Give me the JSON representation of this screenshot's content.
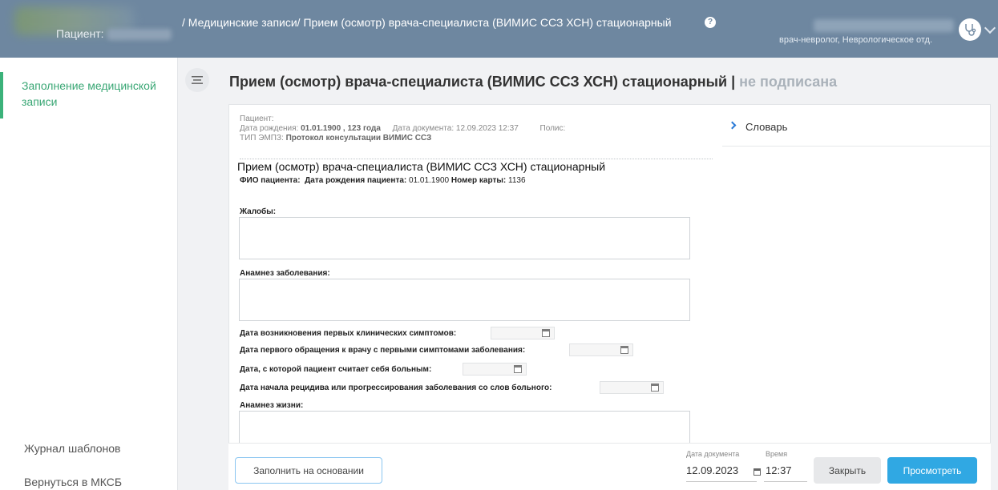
{
  "header": {
    "patient_label": "Пациент:",
    "breadcrumb": "/ Медицинские записи/ Прием (осмотр) врача-специалиста (ВИМИС ССЗ ХСН) стационарный",
    "help_icon": "?",
    "user_role": "врач-невролог, Неврологическое отд."
  },
  "sidebar": {
    "active_item": "Заполнение медицинской записи",
    "templates": "Журнал шаблонов",
    "back": "Вернуться в МКСБ"
  },
  "main": {
    "title": "Прием (осмотр) врача-специалиста (ВИМИС ССЗ ХСН) стационарный | ",
    "status": "не подписана",
    "dictionary": "Словарь"
  },
  "meta": {
    "patient_label": "Пациент:",
    "birth_label": "Дата рождения:",
    "birth_value": "01.01.1900 , 123 года",
    "doc_date_label": "Дата документа:",
    "doc_date_value": "12.09.2023 12:37",
    "policy_label": "Полис:",
    "type_label": "ТИП ЭМПЗ:",
    "type_value": "Протокол консультации ВИМИС ССЗ"
  },
  "document": {
    "title": "Прием (осмотр) врача-специалиста (ВИМИС ССЗ ХСН) стационарный",
    "fio_label": "ФИО пациента:",
    "dob_label": "Дата рождения пациента:",
    "dob_value": "01.01.1900",
    "card_label": "Номер карты:",
    "card_value": "1136",
    "complaints_label": "Жалобы:",
    "anamnesis_label": "Анамнез заболевания:",
    "date_first_symptoms": "Дата возникновения первых клинических симптомов:",
    "date_first_visit": "Дата первого обращения к врачу с первыми симптомами заболевания:",
    "date_ill_since": "Дата, с которой пациент считает себя больным:",
    "date_relapse": "Дата начала рецидива или прогрессирования заболевания со слов больного:",
    "life_anamnesis_label": "Анамнез жизни:"
  },
  "footer": {
    "fill_button": "Заполнить на основании",
    "doc_date_label": "Дата документа",
    "time_label": "Время",
    "doc_date_value": "12.09.2023",
    "time_value": "12:37",
    "close_button": "Закрыть",
    "view_button": "Просмотреть"
  },
  "colors": {
    "header_bg": "#6e87a0",
    "accent_green": "#3aa775",
    "primary_blue": "#30a8e3"
  },
  "icons": [
    "help-icon",
    "stethoscope-icon",
    "chevron-down-icon",
    "menu-icon",
    "chevron-right-icon",
    "calendar-icon"
  ]
}
